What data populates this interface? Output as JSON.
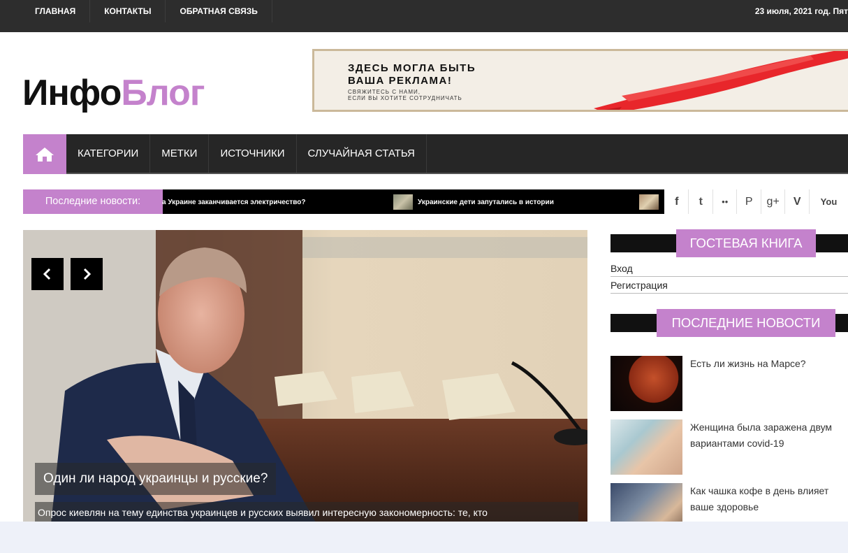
{
  "topnav": {
    "items": [
      "ГЛАВНАЯ",
      "КОНТАКТЫ",
      "ОБРАТНАЯ СВЯЗЬ"
    ],
    "date": "23 июля, 2021 год. Пят"
  },
  "logo": {
    "part1": "Инфо",
    "part2": "Блог"
  },
  "banner": {
    "line1": "ЗДЕСЬ МОГЛА БЫТЬ",
    "line2": "ВАША РЕКЛАМА!",
    "line3": "СВЯЖИТЕСЬ С НАМИ,",
    "line4": "ЕСЛИ ВЫ ХОТИТЕ СОТРУДНИЧАТЬ"
  },
  "mainnav": {
    "items": [
      "КАТЕГОРИИ",
      "МЕТКИ",
      "ИСТОЧНИКИ",
      "СЛУЧАЙНАЯ СТАТЬЯ"
    ]
  },
  "ticker": {
    "label": "Последние новости:",
    "items": [
      "а Украине заканчивается электричество?",
      "Украинские дети запутались в истории"
    ]
  },
  "social": {
    "items": [
      "f",
      "t",
      "••",
      "P",
      "g+",
      "V",
      "You"
    ]
  },
  "slider": {
    "title": "Один ли народ украинцы и русские?",
    "text": "Опрос киевлян на тему единства украинцев и русских выявил интересную закономерность: те, кто"
  },
  "sidebar": {
    "guestbook_title": "ГОСТЕВАЯ КНИГА",
    "links": [
      "Вход",
      "Регистрация"
    ],
    "news_title": "ПОСЛЕДНИЕ НОВОСТИ",
    "news": [
      {
        "text": "Есть ли жизнь на Марсе?"
      },
      {
        "line1": "Женщина была заражена двум",
        "line2": "вариантами covid-19"
      },
      {
        "line1": "Как чашка кофе в день влияет",
        "line2": "ваше здоровье"
      }
    ]
  },
  "colors": {
    "accent": "#c482cc",
    "dark": "#262626"
  }
}
